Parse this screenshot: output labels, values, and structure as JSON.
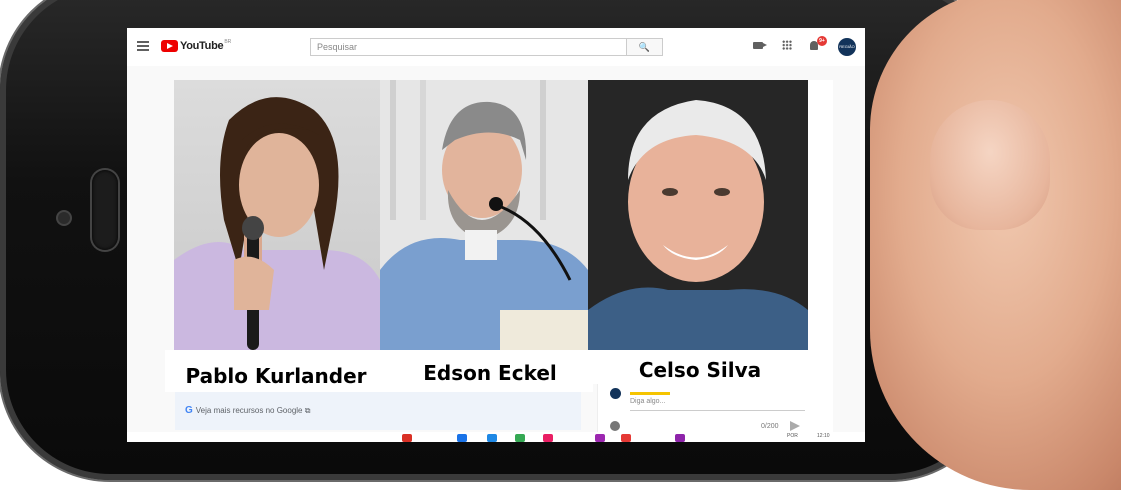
{
  "youtube": {
    "logo_text": "YouTube",
    "logo_country": "BR",
    "search_placeholder": "Pesquisar",
    "search_button": "🔍",
    "notification_count": "9+",
    "avatar_text": "REGIÃO"
  },
  "speakers": [
    {
      "name": "Pablo Kurlander"
    },
    {
      "name": "Edson Eckel"
    },
    {
      "name": "Celso Silva"
    }
  ],
  "page": {
    "google_more": "Veja mais recursos no Google ⧉",
    "chat_placeholder": "Diga algo...",
    "char_count": "0/200",
    "taskbar_time": "12:10",
    "taskbar_date": "POR"
  },
  "colors": {
    "youtube_red": "#ee0000",
    "avatar_bg": "#12335a"
  }
}
